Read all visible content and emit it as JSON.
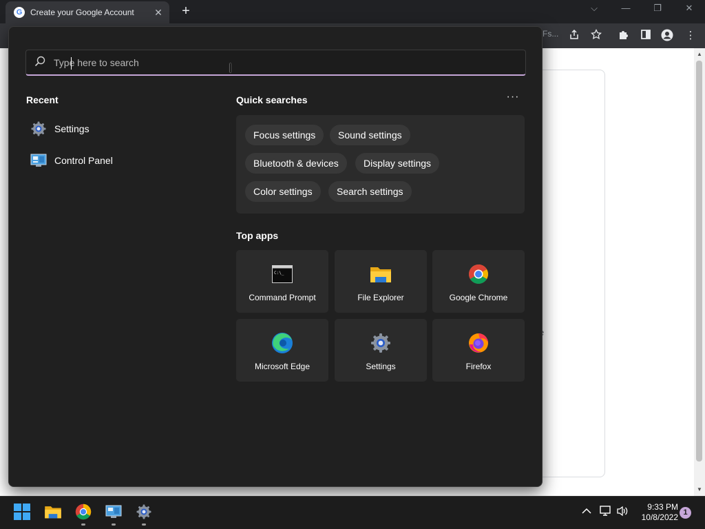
{
  "browser": {
    "tab_title": "Create your Google Account",
    "tab_favicon": "google-favicon",
    "tab_close": "✕",
    "new_tab": "+",
    "omnibox_tail": "Fs...",
    "window_controls": {
      "dropdown": "⌵",
      "minimize": "—",
      "restore": "❐",
      "close": "✕"
    }
  },
  "page": {
    "partial_text": "e"
  },
  "start_panel": {
    "search": {
      "placeholder": "Type here to search",
      "value": ""
    },
    "recent": {
      "title": "Recent",
      "items": [
        {
          "label": "Settings",
          "icon": "settings-gear-icon"
        },
        {
          "label": "Control Panel",
          "icon": "control-panel-icon"
        }
      ]
    },
    "quick_searches": {
      "title": "Quick searches",
      "more_label": "···",
      "chips": [
        "Focus settings",
        "Sound settings",
        "Bluetooth & devices",
        "Display settings",
        "Color settings",
        "Search settings"
      ]
    },
    "top_apps": {
      "title": "Top apps",
      "apps": [
        {
          "label": "Command Prompt",
          "icon": "command-prompt-icon"
        },
        {
          "label": "File Explorer",
          "icon": "file-explorer-icon"
        },
        {
          "label": "Google Chrome",
          "icon": "chrome-icon"
        },
        {
          "label": "Microsoft Edge",
          "icon": "edge-icon"
        },
        {
          "label": "Settings",
          "icon": "settings-gear-icon"
        },
        {
          "label": "Firefox",
          "icon": "firefox-icon"
        }
      ]
    }
  },
  "taskbar": {
    "apps": [
      "start-icon",
      "file-explorer-icon",
      "chrome-icon",
      "control-panel-icon",
      "settings-icon"
    ],
    "clock": {
      "time": "9:33 PM",
      "date": "10/8/2022"
    },
    "notification_count": "1"
  },
  "colors": {
    "panel_bg": "#202020",
    "tile_bg": "#2b2b2b",
    "accent": "#c6a6d8",
    "taskbar_bg": "#1c1c1c"
  }
}
